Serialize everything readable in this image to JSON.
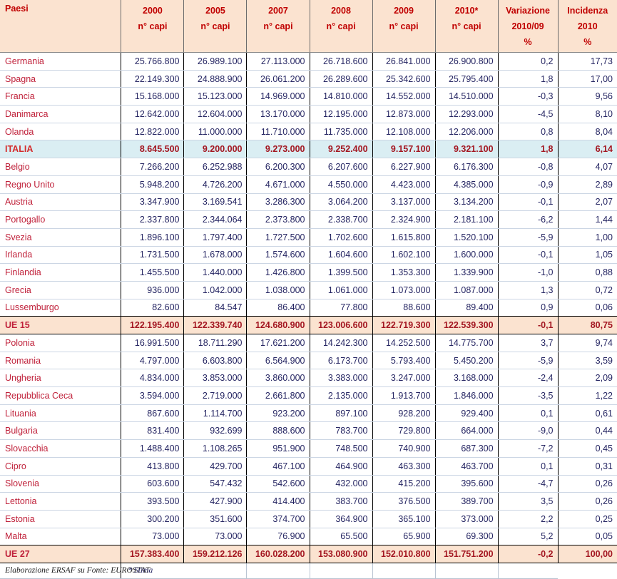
{
  "table": {
    "headers": {
      "country": "Paesi",
      "columns": [
        {
          "line1": "2000",
          "line2": "n° capi",
          "line3": ""
        },
        {
          "line1": "2005",
          "line2": "n° capi",
          "line3": ""
        },
        {
          "line1": "2007",
          "line2": "n° capi",
          "line3": ""
        },
        {
          "line1": "2008",
          "line2": "n° capi",
          "line3": ""
        },
        {
          "line1": "2009",
          "line2": "n° capi",
          "line3": ""
        },
        {
          "line1": "2010*",
          "line2": "n° capi",
          "line3": ""
        },
        {
          "line1": "Variazione",
          "line2": "2010/09",
          "line3": "%"
        },
        {
          "line1": "Incidenza",
          "line2": "2010",
          "line3": "%"
        }
      ]
    },
    "rows": [
      {
        "country": "Germania",
        "v": [
          "25.766.800",
          "26.989.100",
          "27.113.000",
          "26.718.600",
          "26.841.000",
          "26.900.800",
          "0,2",
          "17,73"
        ],
        "style": "normal"
      },
      {
        "country": "Spagna",
        "v": [
          "22.149.300",
          "24.888.900",
          "26.061.200",
          "26.289.600",
          "25.342.600",
          "25.795.400",
          "1,8",
          "17,00"
        ],
        "style": "normal"
      },
      {
        "country": "Francia",
        "v": [
          "15.168.000",
          "15.123.000",
          "14.969.000",
          "14.810.000",
          "14.552.000",
          "14.510.000",
          "-0,3",
          "9,56"
        ],
        "style": "normal"
      },
      {
        "country": "Danimarca",
        "v": [
          "12.642.000",
          "12.604.000",
          "13.170.000",
          "12.195.000",
          "12.873.000",
          "12.293.000",
          "-4,5",
          "8,10"
        ],
        "style": "normal"
      },
      {
        "country": "Olanda",
        "v": [
          "12.822.000",
          "11.000.000",
          "11.710.000",
          "11.735.000",
          "12.108.000",
          "12.206.000",
          "0,8",
          "8,04"
        ],
        "style": "normal"
      },
      {
        "country": "ITALIA",
        "v": [
          "8.645.500",
          "9.200.000",
          "9.273.000",
          "9.252.400",
          "9.157.100",
          "9.321.100",
          "1,8",
          "6,14"
        ],
        "style": "italy"
      },
      {
        "country": "Belgio",
        "v": [
          "7.266.200",
          "6.252.988",
          "6.200.300",
          "6.207.600",
          "6.227.900",
          "6.176.300",
          "-0,8",
          "4,07"
        ],
        "style": "normal"
      },
      {
        "country": "Regno Unito",
        "v": [
          "5.948.200",
          "4.726.200",
          "4.671.000",
          "4.550.000",
          "4.423.000",
          "4.385.000",
          "-0,9",
          "2,89"
        ],
        "style": "normal"
      },
      {
        "country": "Austria",
        "v": [
          "3.347.900",
          "3.169.541",
          "3.286.300",
          "3.064.200",
          "3.137.000",
          "3.134.200",
          "-0,1",
          "2,07"
        ],
        "style": "normal"
      },
      {
        "country": "Portogallo",
        "v": [
          "2.337.800",
          "2.344.064",
          "2.373.800",
          "2.338.700",
          "2.324.900",
          "2.181.100",
          "-6,2",
          "1,44"
        ],
        "style": "normal"
      },
      {
        "country": "Svezia",
        "v": [
          "1.896.100",
          "1.797.400",
          "1.727.500",
          "1.702.600",
          "1.615.800",
          "1.520.100",
          "-5,9",
          "1,00"
        ],
        "style": "normal"
      },
      {
        "country": "Irlanda",
        "v": [
          "1.731.500",
          "1.678.000",
          "1.574.600",
          "1.604.600",
          "1.602.100",
          "1.600.000",
          "-0,1",
          "1,05"
        ],
        "style": "normal"
      },
      {
        "country": "Finlandia",
        "v": [
          "1.455.500",
          "1.440.000",
          "1.426.800",
          "1.399.500",
          "1.353.300",
          "1.339.900",
          "-1,0",
          "0,88"
        ],
        "style": "normal"
      },
      {
        "country": "Grecia",
        "v": [
          "936.000",
          "1.042.000",
          "1.038.000",
          "1.061.000",
          "1.073.000",
          "1.087.000",
          "1,3",
          "0,72"
        ],
        "style": "normal"
      },
      {
        "country": "Lussemburgo",
        "v": [
          "82.600",
          "84.547",
          "86.400",
          "77.800",
          "88.600",
          "89.400",
          "0,9",
          "0,06"
        ],
        "style": "last-data"
      },
      {
        "country": "UE 15",
        "v": [
          "122.195.400",
          "122.339.740",
          "124.680.900",
          "123.006.600",
          "122.719.300",
          "122.539.300",
          "-0,1",
          "80,75"
        ],
        "style": "total"
      },
      {
        "country": "Polonia",
        "v": [
          "16.991.500",
          "18.711.290",
          "17.621.200",
          "14.242.300",
          "14.252.500",
          "14.775.700",
          "3,7",
          "9,74"
        ],
        "style": "normal"
      },
      {
        "country": "Romania",
        "v": [
          "4.797.000",
          "6.603.800",
          "6.564.900",
          "6.173.700",
          "5.793.400",
          "5.450.200",
          "-5,9",
          "3,59"
        ],
        "style": "normal"
      },
      {
        "country": "Ungheria",
        "v": [
          "4.834.000",
          "3.853.000",
          "3.860.000",
          "3.383.000",
          "3.247.000",
          "3.168.000",
          "-2,4",
          "2,09"
        ],
        "style": "normal"
      },
      {
        "country": "Repubblica Ceca",
        "v": [
          "3.594.000",
          "2.719.000",
          "2.661.800",
          "2.135.000",
          "1.913.700",
          "1.846.000",
          "-3,5",
          "1,22"
        ],
        "style": "normal"
      },
      {
        "country": "Lituania",
        "v": [
          "867.600",
          "1.114.700",
          "923.200",
          "897.100",
          "928.200",
          "929.400",
          "0,1",
          "0,61"
        ],
        "style": "normal"
      },
      {
        "country": "Bulgaria",
        "v": [
          "831.400",
          "932.699",
          "888.600",
          "783.700",
          "729.800",
          "664.000",
          "-9,0",
          "0,44"
        ],
        "style": "normal"
      },
      {
        "country": "Slovacchia",
        "v": [
          "1.488.400",
          "1.108.265",
          "951.900",
          "748.500",
          "740.900",
          "687.300",
          "-7,2",
          "0,45"
        ],
        "style": "normal"
      },
      {
        "country": "Cipro",
        "v": [
          "413.800",
          "429.700",
          "467.100",
          "464.900",
          "463.300",
          "463.700",
          "0,1",
          "0,31"
        ],
        "style": "normal"
      },
      {
        "country": "Slovenia",
        "v": [
          "603.600",
          "547.432",
          "542.600",
          "432.000",
          "415.200",
          "395.600",
          "-4,7",
          "0,26"
        ],
        "style": "normal"
      },
      {
        "country": "Lettonia",
        "v": [
          "393.500",
          "427.900",
          "414.400",
          "383.700",
          "376.500",
          "389.700",
          "3,5",
          "0,26"
        ],
        "style": "normal"
      },
      {
        "country": "Estonia",
        "v": [
          "300.200",
          "351.600",
          "374.700",
          "364.900",
          "365.100",
          "373.000",
          "2,2",
          "0,25"
        ],
        "style": "normal"
      },
      {
        "country": "Malta",
        "v": [
          "73.000",
          "73.000",
          "76.900",
          "65.500",
          "65.900",
          "69.300",
          "5,2",
          "0,05"
        ],
        "style": "last-data"
      },
      {
        "country": "UE 27",
        "v": [
          "157.383.400",
          "159.212.126",
          "160.028.200",
          "153.080.900",
          "152.010.800",
          "151.751.200",
          "-0,2",
          "100,00"
        ],
        "style": "total"
      }
    ],
    "footer": {
      "source": "Elaborazione ERSAF su Fonte: EUROSTAT",
      "note": "*  Stima"
    },
    "colors": {
      "header_bg": "#fbe3d0",
      "header_text": "#c00000",
      "country_text": "#c0223b",
      "value_text": "#262663",
      "italy_row_bg": "#daeef3",
      "total_row_bg": "#fbe3d0",
      "total_row_text": "#a31621"
    }
  }
}
